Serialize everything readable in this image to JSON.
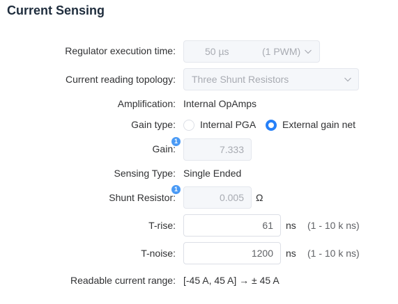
{
  "section_title": "Current Sensing",
  "regulator": {
    "label": "Regulator execution time:",
    "value": "50 µs",
    "suffix": "(1 PWM)"
  },
  "topology": {
    "label": "Current reading topology:",
    "value": "Three Shunt Resistors"
  },
  "amplification": {
    "label": "Amplification:",
    "value": "Internal OpAmps"
  },
  "gain_type": {
    "label": "Gain type:",
    "options": [
      "Internal PGA",
      "External gain net"
    ],
    "selected": "External gain net"
  },
  "gain": {
    "label": "Gain:",
    "value": "7.333",
    "badge": "1"
  },
  "sensing_type": {
    "label": "Sensing Type:",
    "value": "Single Ended"
  },
  "shunt": {
    "label": "Shunt Resistor:",
    "value": "0.005",
    "unit": "Ω",
    "badge": "1"
  },
  "t_rise": {
    "label": "T-rise:",
    "value": "61",
    "unit": "ns",
    "range": "(1 - 10 k ns)"
  },
  "t_noise": {
    "label": "T-noise:",
    "value": "1200",
    "unit": "ns",
    "range": "(1 - 10 k ns)"
  },
  "readable": {
    "label": "Readable current range:",
    "value": "[-45 A, 45 A] → ± 45 A"
  },
  "colors": {
    "accent": "#2680f8",
    "badge": "#4a9af5",
    "border": "#dcdfe6",
    "placeholder": "#a8abb2"
  }
}
